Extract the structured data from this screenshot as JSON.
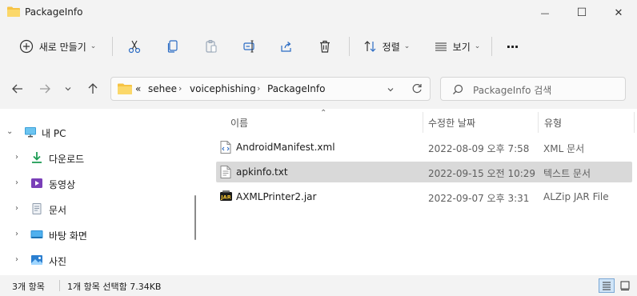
{
  "window": {
    "title": "PackageInfo",
    "minimize_glyph": "—",
    "maximize_glyph": "☐",
    "close_glyph": "✕"
  },
  "toolbar": {
    "new_label": "새로 만들기",
    "sort_label": "정렬",
    "view_label": "보기",
    "more_label": "···"
  },
  "address": {
    "overflow": "«",
    "crumbs": [
      "sehee",
      "voicephishing",
      "PackageInfo"
    ]
  },
  "search": {
    "placeholder": "PackageInfo 검색"
  },
  "nav": {
    "items": [
      {
        "label": "내 PC",
        "icon": "monitor-icon"
      },
      {
        "label": "다운로드",
        "icon": "download-icon"
      },
      {
        "label": "동영상",
        "icon": "video-icon"
      },
      {
        "label": "문서",
        "icon": "document-icon"
      },
      {
        "label": "바탕 화면",
        "icon": "desktop-icon"
      },
      {
        "label": "사진",
        "icon": "picture-icon"
      }
    ]
  },
  "columns": {
    "name": "이름",
    "modified": "수정한 날짜",
    "type": "유형"
  },
  "files": [
    {
      "name": "AndroidManifest.xml",
      "modified": "2022-08-09 오후 7:58",
      "type": "XML 문서",
      "icon": "xml-file-icon",
      "selected": false
    },
    {
      "name": "apkinfo.txt",
      "modified": "2022-09-15 오전 10:29",
      "type": "텍스트 문서",
      "icon": "text-file-icon",
      "selected": true
    },
    {
      "name": "AXMLPrinter2.jar",
      "modified": "2022-09-07 오후 3:31",
      "type": "ALZip JAR File",
      "icon": "jar-file-icon",
      "selected": false
    }
  ],
  "status": {
    "count": "3개 항목",
    "selection": "1개 항목 선택함 7.34KB"
  },
  "colors": {
    "folder": "#f6c344",
    "selected_row": "#d9d9d9",
    "accent": "#0067c0"
  }
}
